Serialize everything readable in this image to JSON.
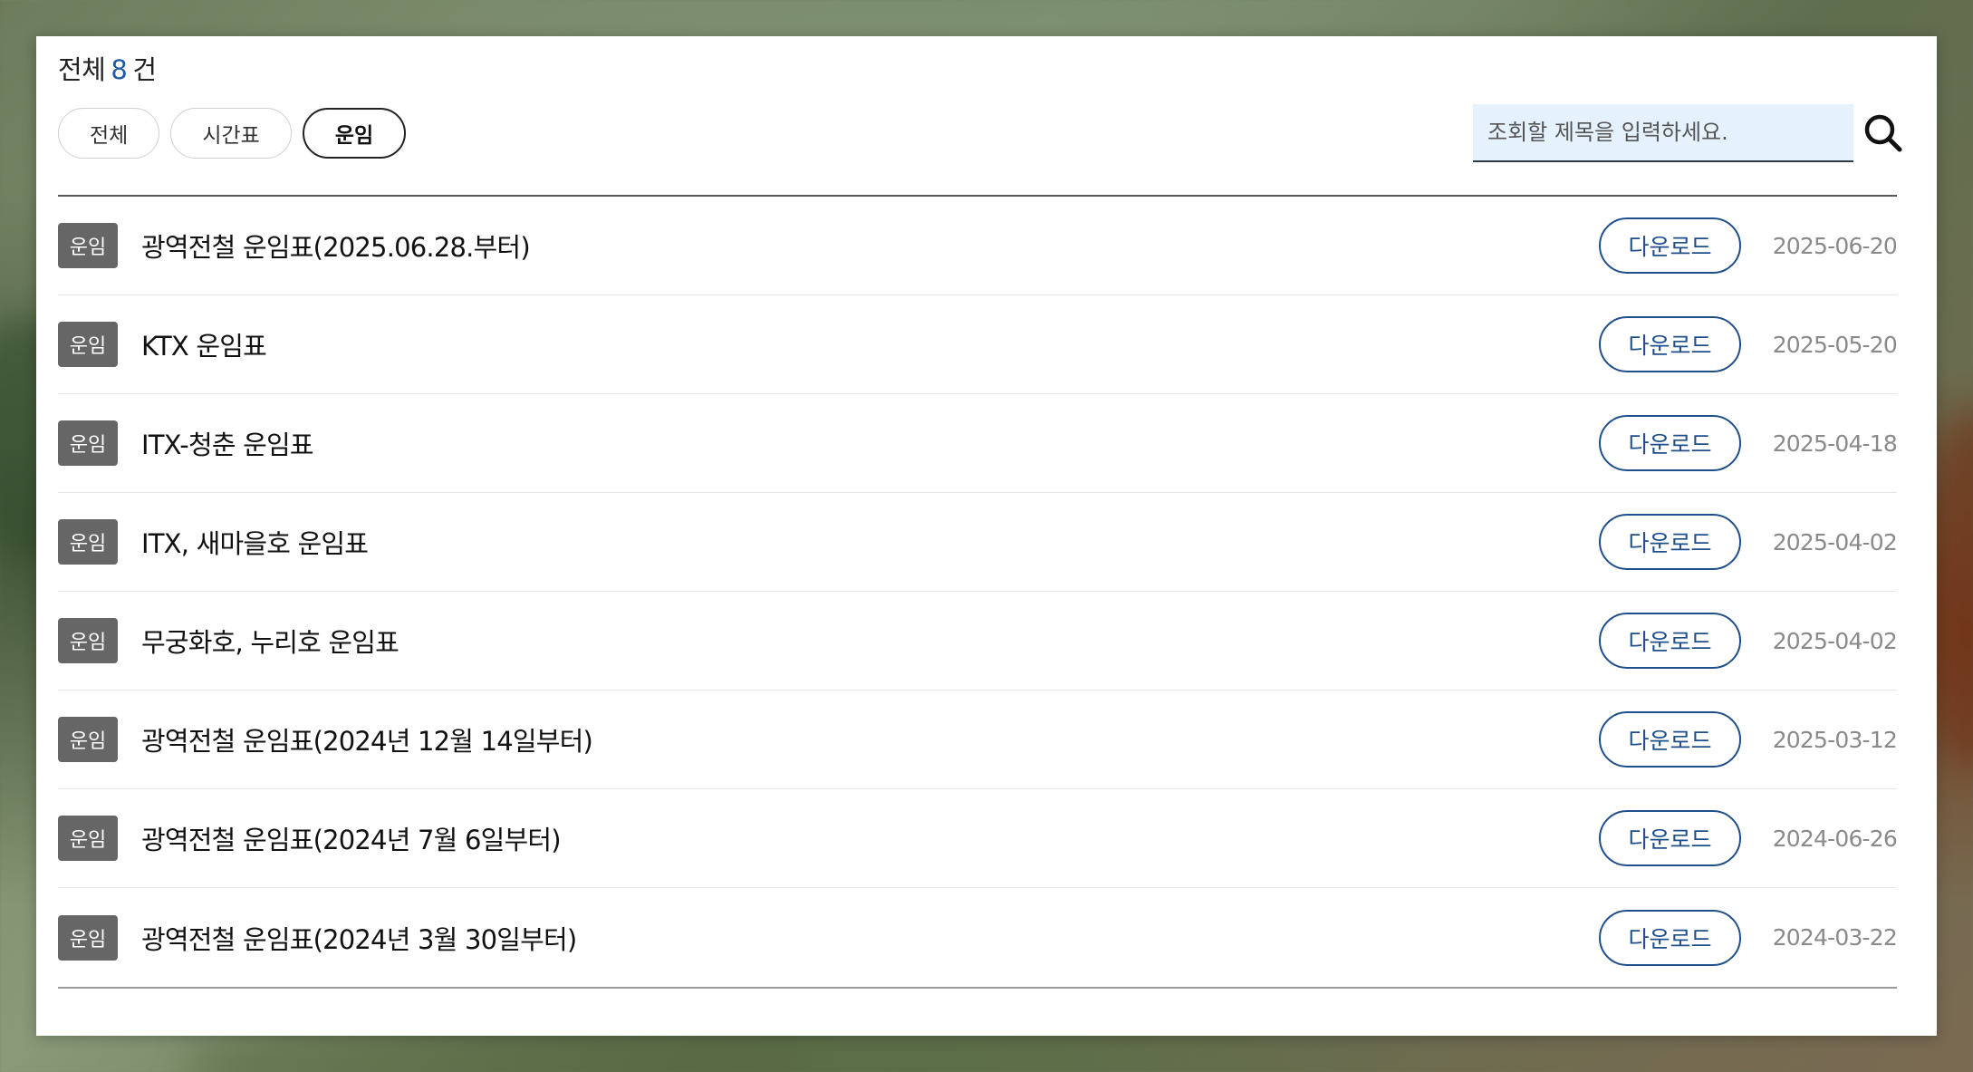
{
  "summary": {
    "prefix": "전체",
    "count": "8",
    "suffix": "건"
  },
  "filters": [
    {
      "label": "전체",
      "active": false
    },
    {
      "label": "시간표",
      "active": false
    },
    {
      "label": "운임",
      "active": true
    }
  ],
  "search": {
    "placeholder": "조회할 제목을 입력하세요.",
    "value": ""
  },
  "download_label": "다운로드",
  "rows": [
    {
      "tag": "운임",
      "title": "광역전철 운임표(2025.06.28.부터)",
      "date": "2025-06-20"
    },
    {
      "tag": "운임",
      "title": "KTX 운임표",
      "date": "2025-05-20"
    },
    {
      "tag": "운임",
      "title": "ITX-청춘 운임표",
      "date": "2025-04-18"
    },
    {
      "tag": "운임",
      "title": "ITX, 새마을호 운임표",
      "date": "2025-04-02"
    },
    {
      "tag": "운임",
      "title": "무궁화호, 누리호 운임표",
      "date": "2025-04-02"
    },
    {
      "tag": "운임",
      "title": "광역전철 운임표(2024년 12월 14일부터)",
      "date": "2025-03-12"
    },
    {
      "tag": "운임",
      "title": "광역전철 운임표(2024년 7월 6일부터)",
      "date": "2024-06-26"
    },
    {
      "tag": "운임",
      "title": "광역전철 운임표(2024년 3월 30일부터)",
      "date": "2024-03-22"
    }
  ],
  "colors": {
    "accent": "#1f4f8a",
    "count": "#1f5aa8",
    "tag_bg": "#666666"
  },
  "icons": {
    "search": "search-icon"
  }
}
